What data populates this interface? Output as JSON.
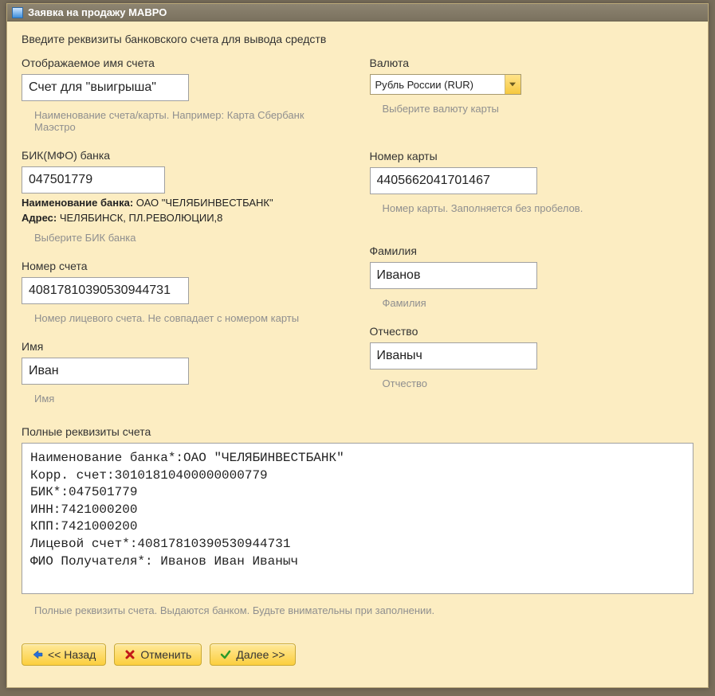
{
  "window": {
    "title": "Заявка на продажу МАВРО"
  },
  "intro": "Введите реквизиты банковского счета для вывода средств",
  "left": {
    "account_name": {
      "label": "Отображаемое имя счета",
      "value": "Счет для \"выигрыша\"",
      "hint": "Наименование счета/карты. Например: Карта Сбербанк Маэстро"
    },
    "bik": {
      "label": "БИК(МФО) банка",
      "value": "047501779",
      "bank_name_label": "Наименование банка:",
      "bank_name_value": "ОАО \"ЧЕЛЯБИНВЕСТБАНК\"",
      "bank_addr_label": "Адрес:",
      "bank_addr_value": "ЧЕЛЯБИНСК, ПЛ.РЕВОЛЮЦИИ,8",
      "hint": "Выберите БИК банка"
    },
    "account_number": {
      "label": "Номер счета",
      "value": "40817810390530944731",
      "hint": "Номер лицевого счета. Не совпадает с номером карты"
    },
    "first_name": {
      "label": "Имя",
      "value": "Иван",
      "hint": "Имя"
    }
  },
  "right": {
    "currency": {
      "label": "Валюта",
      "value": "Рубль России (RUR)",
      "hint": "Выберите валюту карты"
    },
    "card_number": {
      "label": "Номер карты",
      "value": "4405662041701467",
      "hint": "Номер карты. Заполняется без пробелов."
    },
    "last_name": {
      "label": "Фамилия",
      "value": "Иванов",
      "hint": "Фамилия"
    },
    "middle_name": {
      "label": "Отчество",
      "value": "Иваныч",
      "hint": "Отчество"
    }
  },
  "full": {
    "label": "Полные реквизиты счета",
    "value": "Наименование банка*:ОАО \"ЧЕЛЯБИНВЕСТБАНК\"\nКорр. счет:30101810400000000779\nБИК*:047501779\nИНН:7421000200\nКПП:7421000200\nЛицевой счет*:40817810390530944731\nФИО Получателя*: Иванов Иван Иваныч",
    "hint": "Полные реквизиты счета. Выдаются банком. Будьте внимательны при заполнении."
  },
  "buttons": {
    "back": "<< Назад",
    "cancel": "Отменить",
    "next": "Далее >>"
  }
}
